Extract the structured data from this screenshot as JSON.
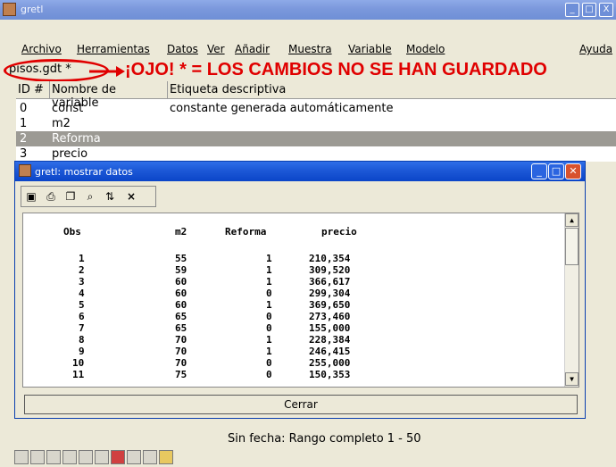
{
  "main_window": {
    "title": "gretl",
    "controls": [
      "_",
      "□",
      "X"
    ]
  },
  "menu": [
    "Archivo",
    "Herramientas",
    "Datos",
    "Ver",
    "Añadir",
    "Muestra",
    "Variable",
    "Modelo",
    "Ayuda"
  ],
  "file_name": "pisos.gdt *",
  "annotation": {
    "warning_text": "¡OJO! * = LOS CAMBIOS NO SE HAN GUARDADO",
    "color": "#e00000"
  },
  "variable_list": {
    "headers": [
      "ID #",
      "Nombre de variable",
      "Etiqueta descriptiva"
    ],
    "rows": [
      {
        "id": "0",
        "name": "const",
        "label": "constante generada automáticamente"
      },
      {
        "id": "1",
        "name": "m2",
        "label": ""
      },
      {
        "id": "2",
        "name": "Reforma",
        "label": "",
        "selected": true
      },
      {
        "id": "3",
        "name": "precio",
        "label": ""
      }
    ]
  },
  "status": "Sin fecha: Rango completo 1 - 50",
  "data_window": {
    "title": "gretl: mostrar datos",
    "toolbar_icons": [
      "edit-icon",
      "print-icon",
      "copy-icon",
      "find-icon",
      "sort-icon",
      "close-icon"
    ],
    "columns": [
      "Obs",
      "m2",
      "Reforma",
      "precio"
    ],
    "rows": [
      [
        "1",
        "55",
        "1",
        "210,354"
      ],
      [
        "2",
        "59",
        "1",
        "309,520"
      ],
      [
        "3",
        "60",
        "1",
        "366,617"
      ],
      [
        "4",
        "60",
        "0",
        "299,304"
      ],
      [
        "5",
        "60",
        "1",
        "369,650"
      ],
      [
        "6",
        "65",
        "0",
        "273,460"
      ],
      [
        "7",
        "65",
        "0",
        "155,000"
      ],
      [
        "8",
        "70",
        "1",
        "228,384"
      ],
      [
        "9",
        "70",
        "1",
        "246,415"
      ],
      [
        "10",
        "70",
        "0",
        "255,000"
      ],
      [
        "11",
        "75",
        "0",
        "150,353"
      ]
    ],
    "close_button": "Cerrar"
  },
  "bottom_toolbar_icons": [
    "calculator-icon",
    "script-icon",
    "console-icon",
    "session-icon",
    "graph-icon",
    "model-icon",
    "gretl-icon",
    "plot-icon",
    "beta-icon",
    "folder-icon"
  ]
}
